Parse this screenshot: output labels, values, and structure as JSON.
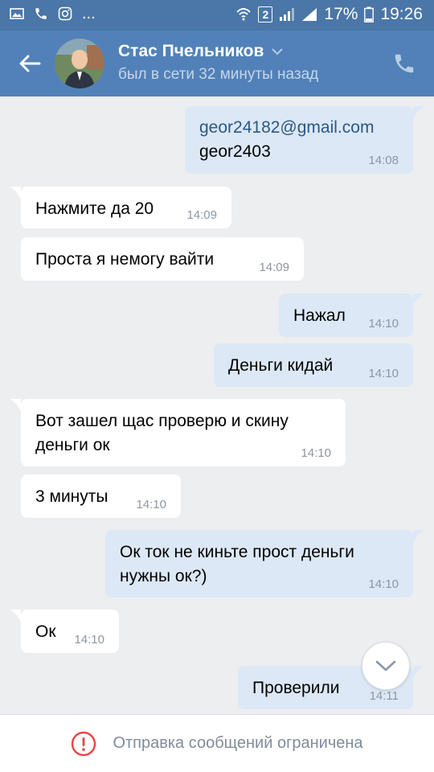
{
  "status_bar": {
    "battery_percent": "17%",
    "time": "19:26",
    "sim_badge": "2"
  },
  "header": {
    "contact_name": "Стас Пчельников",
    "contact_status": "был в сети 32 минуты назад"
  },
  "messages": [
    {
      "dir": "out",
      "lines": [
        "geor24182@gmail.com",
        "geor2403"
      ],
      "time": "14:08"
    },
    {
      "dir": "in",
      "lines": [
        "Нажмите да 20"
      ],
      "time": "14:09"
    },
    {
      "dir": "in",
      "lines": [
        "Проста я немогу вайти"
      ],
      "time": "14:09"
    },
    {
      "dir": "out",
      "lines": [
        "Нажал"
      ],
      "time": "14:10"
    },
    {
      "dir": "out",
      "lines": [
        "Деньги кидай"
      ],
      "time": "14:10"
    },
    {
      "dir": "in",
      "lines": [
        "Вот зашел щас проверю и скину",
        "деньги ок"
      ],
      "time": "14:10"
    },
    {
      "dir": "in",
      "lines": [
        "3 минуты"
      ],
      "time": "14:10"
    },
    {
      "dir": "out",
      "lines": [
        "Ок ток не киньте прост деньги",
        "нужны ок?)"
      ],
      "time": "14:10"
    },
    {
      "dir": "in",
      "lines": [
        "Ок"
      ],
      "time": "14:10"
    },
    {
      "dir": "out",
      "lines": [
        "Проверили"
      ],
      "time": "14:11"
    }
  ],
  "footer": {
    "notice": "Отправка сообщений ограничена"
  },
  "colors": {
    "header": "#5181b8",
    "status_bar": "#4a76a8",
    "incoming_bubble": "#ffffff",
    "outgoing_bubble": "#dce8f6",
    "background": "#edeef0",
    "warning": "#e64646"
  },
  "icons": {
    "back": "arrow-left-icon",
    "call": "phone-icon",
    "dropdown": "chevron-down-icon",
    "scroll_down": "chevron-down-icon",
    "warning": "exclamation-circle-icon"
  }
}
